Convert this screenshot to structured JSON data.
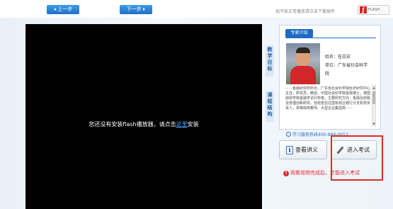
{
  "toolbar": {
    "prev_label": "◂ 上一步",
    "next_label": "下一步 ▸",
    "flash_hint": "如不能正常播放请点击下载插件",
    "flash_logo_text": "FLASH"
  },
  "player": {
    "message_before": "您还没有安装flash播放器，请点击",
    "message_link": "这里",
    "message_after": "安装"
  },
  "side_tabs": {
    "tab1": "教学目标",
    "tab2": "课程结构"
  },
  "expert": {
    "panel_title": "专家介绍",
    "name_line": "姓名：任志宏",
    "unit_line": "单位：广东省社会科学",
    "unit_line2": "院",
    "bio": "⋯⋯金融研究所所长，广东省社会科学院经济研究中心主任，研究员，教授。中国社会科学院金融博士，德国财政学院金融学访问学者，主要研究方向：金融及财税及管理创新研究。曾经担任过国有商业银行分支机构负责人，高等院校教师、大型企业集团高⋯⋯"
  },
  "hotline": "学习服务热线400-888-0053",
  "buttons": {
    "lecture": "查看讲义",
    "exam": "进入考试"
  },
  "notice": "观看视频完成后，才能进入考试",
  "colors": {
    "accent": "#1d6bc4",
    "alert": "#e02a2a"
  }
}
